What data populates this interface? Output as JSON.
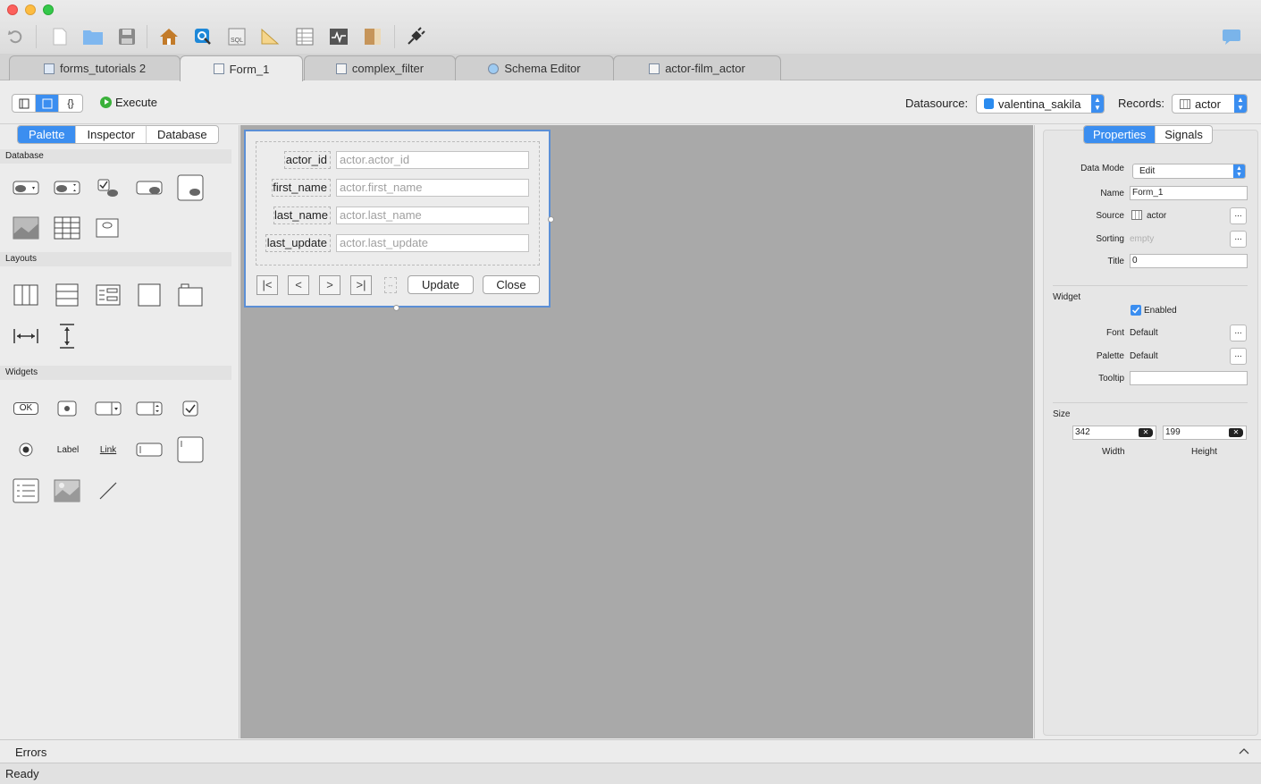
{
  "toolbar": {
    "icons": [
      "undo-icon",
      "new-document-icon",
      "open-folder-icon",
      "save-icon",
      "home-icon",
      "query-icon",
      "sql-icon",
      "report-icon",
      "table-icon",
      "monitor-icon",
      "book-icon",
      "plug-icon",
      "chat-icon"
    ]
  },
  "tabs": [
    {
      "label": "forms_tutorials 2",
      "active": false
    },
    {
      "label": "Form_1",
      "active": true
    },
    {
      "label": "complex_filter",
      "active": false
    },
    {
      "label": "Schema Editor",
      "active": false
    },
    {
      "label": "actor-film_actor",
      "active": false
    }
  ],
  "actions": {
    "execute_label": "Execute",
    "datasource_label": "Datasource:",
    "datasource_value": "valentina_sakila",
    "records_label": "Records:",
    "records_value": "actor"
  },
  "left_panel": {
    "tabs": [
      "Palette",
      "Inspector",
      "Database"
    ],
    "active_tab": "Palette",
    "sections": {
      "database": "Database",
      "layouts": "Layouts",
      "widgets": "Widgets"
    },
    "widget_labels": {
      "ok": "OK",
      "label": "Label",
      "link": "Link"
    }
  },
  "form": {
    "fields": [
      {
        "label": "actor_id",
        "placeholder": "actor.actor_id"
      },
      {
        "label": "first_name",
        "placeholder": "actor.first_name"
      },
      {
        "label": "last_name",
        "placeholder": "actor.last_name"
      },
      {
        "label": "last_update",
        "placeholder": "actor.last_update"
      }
    ],
    "nav": [
      "|<",
      "<",
      ">",
      ">|"
    ],
    "update_label": "Update",
    "close_label": "Close"
  },
  "right_panel": {
    "tabs": [
      "Properties",
      "Signals"
    ],
    "active_tab": "Properties",
    "data_mode_label": "Data Mode",
    "data_mode_value": "Edit",
    "name_label": "Name",
    "name_value": "Form_1",
    "source_label": "Source",
    "source_value": "actor",
    "sorting_label": "Sorting",
    "sorting_value": "empty",
    "title_label": "Title",
    "title_value": "0",
    "widget_header": "Widget",
    "enabled_label": "Enabled",
    "enabled_checked": true,
    "font_label": "Font",
    "font_value": "Default",
    "palette_label": "Palette",
    "palette_value": "Default",
    "tooltip_label": "Tooltip",
    "tooltip_value": "",
    "size_header": "Size",
    "width_value": "342",
    "height_value": "199",
    "width_label": "Width",
    "height_label": "Height",
    "dots": "..."
  },
  "bottom": {
    "errors_label": "Errors",
    "status_text": "Ready"
  },
  "colors": {
    "accent": "#3b8ef0",
    "canvas": "#a9a9a9",
    "form_border": "#5b8fd6"
  }
}
